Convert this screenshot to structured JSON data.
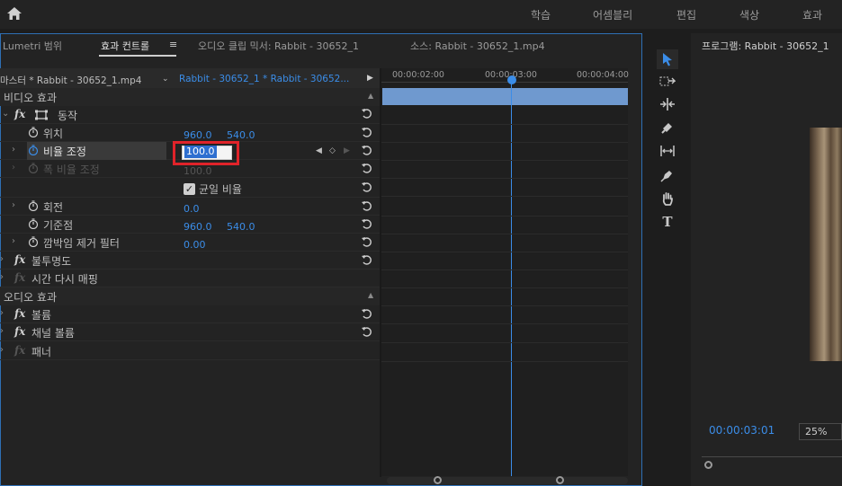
{
  "workspaces": [
    "학습",
    "어셈블리",
    "편집",
    "색상",
    "효과"
  ],
  "tabs": {
    "lumetri": "Lumetri 범위",
    "effect_controls": "효과 컨트롤",
    "menu_icon": "≡",
    "audio_mixer": "오디오 클립 믹서: Rabbit - 30652_1",
    "source": "소스: Rabbit - 30652_1.mp4"
  },
  "breadcrumb": {
    "master": "마스터 * Rabbit - 30652_1.mp4",
    "sequence": "Rabbit - 30652_1 * Rabbit - 30652..."
  },
  "timecodes": {
    "t1": "00:00:02:00",
    "t2": "00:00:03:00",
    "t3": "00:00:04:00"
  },
  "sections": {
    "video": "비디오 효과",
    "audio": "오디오 효과"
  },
  "effects": {
    "motion": "동작",
    "position": {
      "label": "위치",
      "x": "960.0",
      "y": "540.0"
    },
    "scale": {
      "label": "비율 조정",
      "value": "100.0"
    },
    "scale_width": {
      "label": "폭 비율 조정",
      "value": "100.0"
    },
    "uniform": {
      "label": "균일 비율"
    },
    "rotation": {
      "label": "회전",
      "value": "0.0"
    },
    "anchor": {
      "label": "기준점",
      "x": "960.0",
      "y": "540.0"
    },
    "flicker": {
      "label": "깜박임 제거 필터",
      "value": "0.00"
    },
    "opacity": "불투명도",
    "remap": "시간 다시 매핑",
    "volume": "볼륨",
    "channel_volume": "채널 볼륨",
    "panner": "패너"
  },
  "fx_glyph": "fx",
  "program": {
    "title": "프로그램: Rabbit - 30652_1",
    "timecode": "00:00:03:01",
    "zoom": "25%"
  },
  "colors": {
    "accent": "#3b8de8",
    "highlight": "#e0232a",
    "clip": "#6f99cf"
  }
}
